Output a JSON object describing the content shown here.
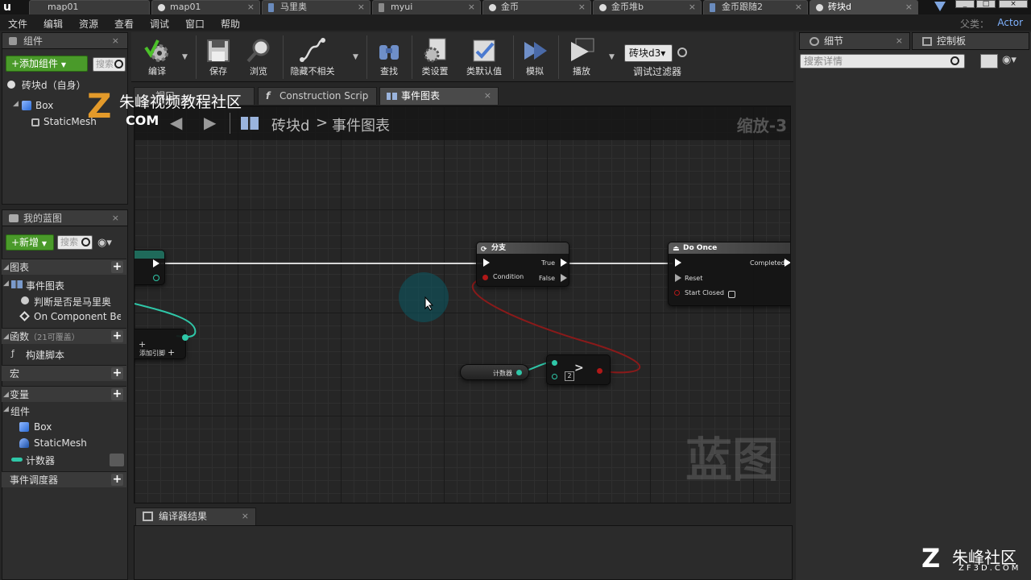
{
  "doc_tabs": [
    {
      "label": "map01",
      "type": "ue-logo"
    },
    {
      "label": "map01",
      "type": "level"
    },
    {
      "label": "马里奥",
      "type": "blueprint"
    },
    {
      "label": "myui",
      "type": "widget"
    },
    {
      "label": "金币",
      "type": "level"
    },
    {
      "label": "金币堆b",
      "type": "level"
    },
    {
      "label": "金币跟随2",
      "type": "blueprint"
    },
    {
      "label": "砖块d",
      "type": "level",
      "active": true
    }
  ],
  "menu": [
    "文件",
    "编辑",
    "资源",
    "查看",
    "调试",
    "窗口",
    "帮助"
  ],
  "parent_class": {
    "label": "父类：",
    "value": "Actor"
  },
  "components_panel": {
    "title": "组件",
    "add_button": "+添加组件",
    "search_placeholder": "搜索",
    "self_item": "砖块d（自身）",
    "tree": [
      "Box",
      "StaticMesh"
    ]
  },
  "my_blueprint": {
    "title": "我的蓝图",
    "new_button": "+新增",
    "search_placeholder": "搜索",
    "sections": {
      "graphs": "图表",
      "event_graph": "事件图表",
      "event_items": [
        "判断是否是马里奥",
        "On Component Beg"
      ],
      "functions": "函数",
      "functions_note": "（21可覆盖）",
      "construction_script": "构建脚本",
      "macros": "宏",
      "variables": "变量",
      "components": "组件",
      "component_vars": [
        "Box",
        "StaticMesh"
      ],
      "counter_var": "计数器",
      "event_dispatchers": "事件调度器"
    }
  },
  "toolbar": {
    "compile": "编译",
    "save": "保存",
    "browse": "浏览",
    "hide_unrelated": "隐藏不相关",
    "find": "查找",
    "class_settings": "类设置",
    "class_defaults": "类默认值",
    "simulate": "模拟",
    "play": "播放",
    "debug_object": "砖块d3▾",
    "debug_filter": "调试过滤器"
  },
  "graph_tabs": [
    {
      "label": "视口",
      "active": false
    },
    {
      "label": "Construction Scrip",
      "active": false
    },
    {
      "label": "事件图表",
      "active": true
    }
  ],
  "graph": {
    "breadcrumb_bp": "砖块d",
    "breadcrumb_sep": ">",
    "breadcrumb_graph": "事件图表",
    "zoom": "缩放-3",
    "watermark": "蓝图",
    "branch_node": {
      "title": "分支",
      "true": "True",
      "false": "False",
      "condition": "Condition"
    },
    "do_once_node": {
      "title": "Do Once",
      "completed": "Completed",
      "reset": "Reset",
      "start_closed": "Start Closed"
    },
    "counter_node": {
      "label": "计数器"
    },
    "compare_node": {
      "op": ">",
      "value": "2"
    },
    "add_pin_label": "添加引脚"
  },
  "right_panel": {
    "details_tab": "细节",
    "palette_tab": "控制板",
    "search_placeholder": "搜索详情"
  },
  "compiler_results": {
    "title": "编译器结果"
  },
  "watermarks": {
    "top_text": "朱峰视频教程社区",
    "top_com": "COM",
    "bottom_main": "朱峰社区",
    "bottom_url": "ZF3D.COM"
  },
  "colors": {
    "accent_green": "#4a9a2a",
    "bool_wire": "#8a1a1a",
    "int_wire": "#2fc7a8",
    "exec_wire": "#ffffff"
  }
}
